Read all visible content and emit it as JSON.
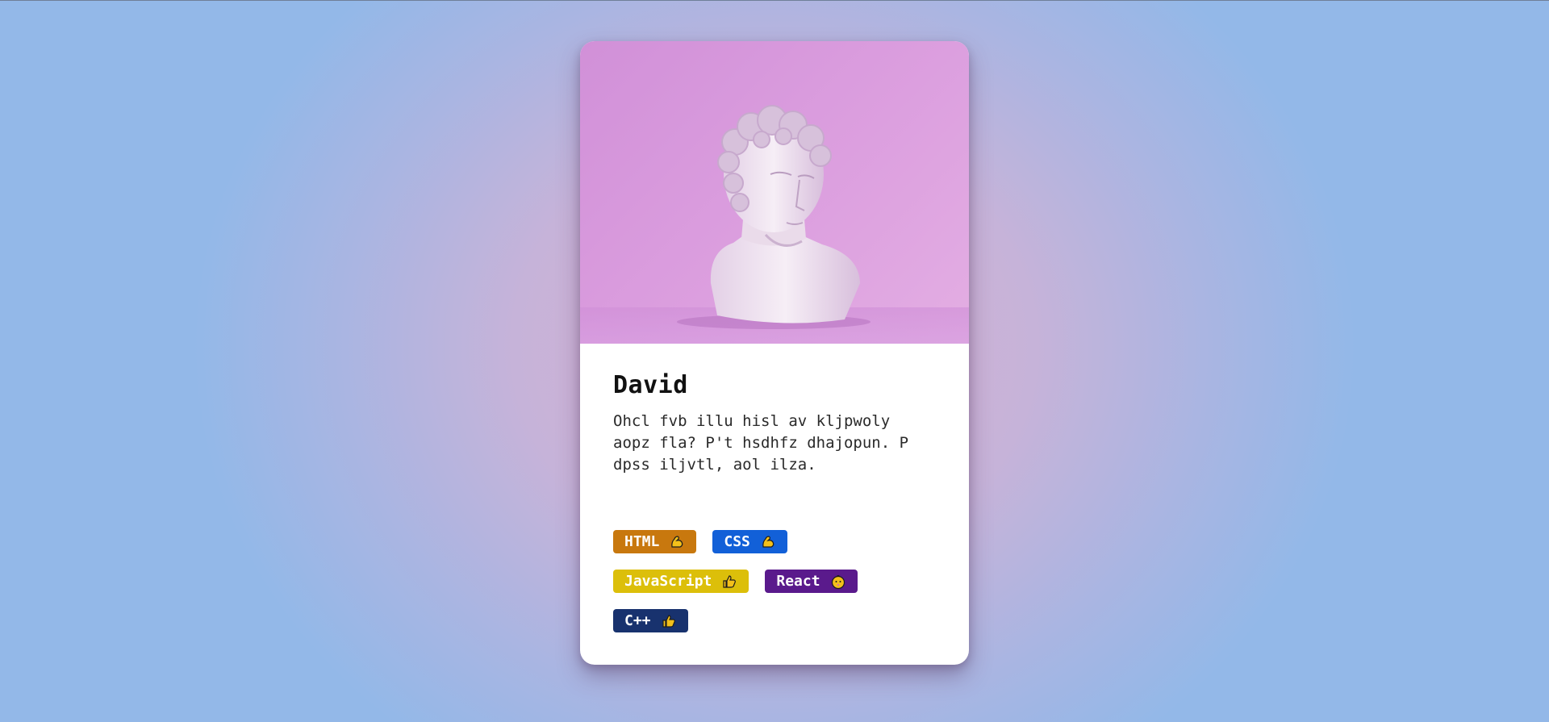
{
  "profile": {
    "name": "David",
    "bio": "Ohcl fvb illu hisl av kljpwoly aopz fla? P't hsdhfz dhajopun. P dpss iljvtl, aol ilza."
  },
  "skills": [
    {
      "label": "HTML",
      "icon": "flexed-bicep-icon",
      "color": "#c8780e"
    },
    {
      "label": "CSS",
      "icon": "flexed-bicep-icon",
      "color": "#1260d8"
    },
    {
      "label": "JavaScript",
      "icon": "thumbs-up-icon",
      "color": "#dcbf0a"
    },
    {
      "label": "React",
      "icon": "baby-face-icon",
      "color": "#5a1a8c"
    },
    {
      "label": "C++",
      "icon": "thumbs-up-icon",
      "color": "#18326e"
    }
  ]
}
